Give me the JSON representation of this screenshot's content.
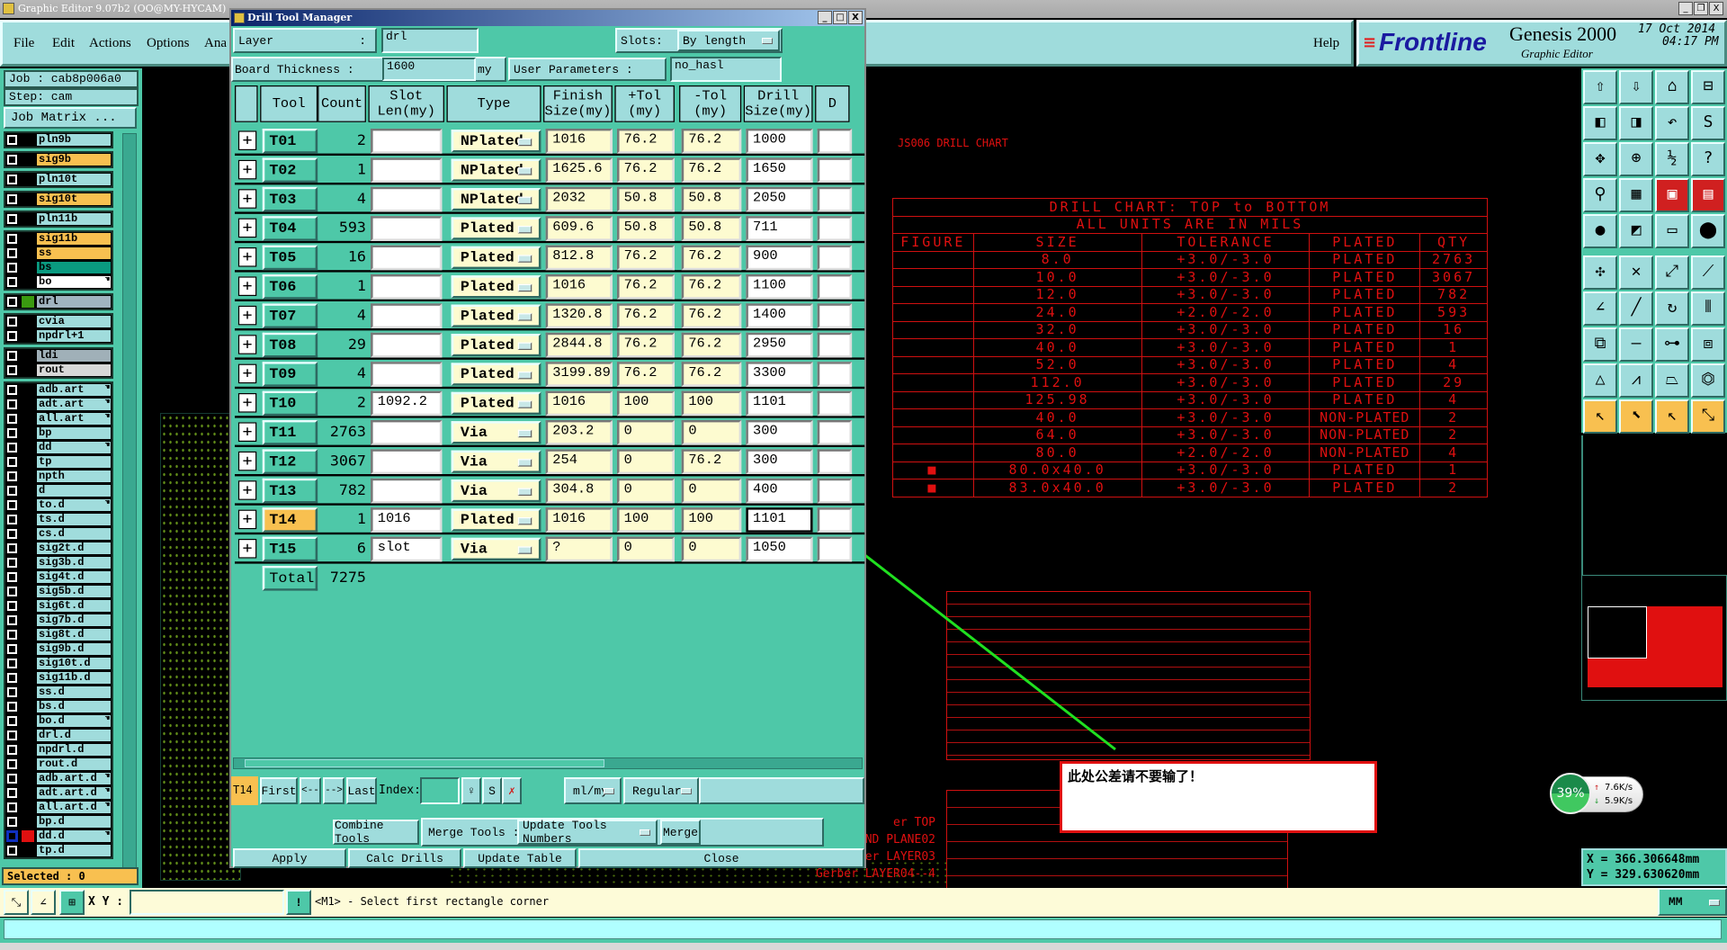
{
  "app": {
    "title": "Graphic Editor 9.07b2 (OO@MY-HYCAM)",
    "menu": [
      "File",
      "Edit",
      "Actions",
      "Options",
      "Ana"
    ],
    "help": "Help",
    "brand": "Frontline",
    "product": "Genesis 2000",
    "subtitle": "Graphic Editor",
    "date": "17 Oct 2014",
    "time": "04:17 PM"
  },
  "left_panel": {
    "job": "Job : cab8p006a0",
    "step": "Step: cam",
    "job_matrix": "Job Matrix ...",
    "layer_groups": [
      [
        {
          "name": "pln9b",
          "color": "#a0dcdc"
        }
      ],
      [
        {
          "name": "sig9b",
          "color": "#f8c050"
        }
      ],
      [
        {
          "name": "pln10t",
          "color": "#a0dcdc"
        }
      ],
      [
        {
          "name": "sig10t",
          "color": "#f8c050"
        }
      ],
      [
        {
          "name": "pln11b",
          "color": "#a0dcdc"
        }
      ],
      [
        {
          "name": "sig11b",
          "color": "#f8c050"
        },
        {
          "name": "ss",
          "color": "#f8c050"
        },
        {
          "name": "bs",
          "color": "#0a9a80"
        },
        {
          "name": "bo",
          "color": "#ffffff",
          "hand": true
        }
      ],
      [
        {
          "name": "drl",
          "color": "#a0b4c0",
          "swatch": "#3a9a10"
        }
      ],
      [
        {
          "name": "cvia",
          "color": "#a0dcdc"
        },
        {
          "name": "npdrl+1",
          "color": "#a0dcdc"
        }
      ],
      [
        {
          "name": "ldi",
          "color": "#a0b0b8"
        },
        {
          "name": "rout",
          "color": "#d8d8d8"
        }
      ],
      [
        {
          "name": "adb.art",
          "color": "#a0dcdc",
          "hand": true
        },
        {
          "name": "adt.art",
          "color": "#a0dcdc",
          "hand": true
        },
        {
          "name": "all.art",
          "color": "#a0dcdc",
          "hand": true
        },
        {
          "name": "bp",
          "color": "#a0dcdc"
        },
        {
          "name": "dd",
          "color": "#a0dcdc",
          "hand": true
        },
        {
          "name": "tp",
          "color": "#a0dcdc"
        },
        {
          "name": "npth",
          "color": "#a0dcdc"
        },
        {
          "name": "d",
          "color": "#a0dcdc"
        },
        {
          "name": "to.d",
          "color": "#a0dcdc",
          "hand": true
        },
        {
          "name": "ts.d",
          "color": "#a0dcdc"
        },
        {
          "name": "cs.d",
          "color": "#a0dcdc"
        },
        {
          "name": "sig2t.d",
          "color": "#a0dcdc"
        },
        {
          "name": "sig3b.d",
          "color": "#a0dcdc"
        },
        {
          "name": "sig4t.d",
          "color": "#a0dcdc"
        },
        {
          "name": "sig5b.d",
          "color": "#a0dcdc"
        },
        {
          "name": "sig6t.d",
          "color": "#a0dcdc"
        },
        {
          "name": "sig7b.d",
          "color": "#a0dcdc"
        },
        {
          "name": "sig8t.d",
          "color": "#a0dcdc"
        },
        {
          "name": "sig9b.d",
          "color": "#a0dcdc"
        },
        {
          "name": "sig10t.d",
          "color": "#a0dcdc"
        },
        {
          "name": "sig11b.d",
          "color": "#a0dcdc"
        },
        {
          "name": "ss.d",
          "color": "#a0dcdc"
        },
        {
          "name": "bs.d",
          "color": "#a0dcdc"
        },
        {
          "name": "bo.d",
          "color": "#a0dcdc",
          "hand": true
        },
        {
          "name": "drl.d",
          "color": "#a0dcdc"
        },
        {
          "name": "npdrl.d",
          "color": "#a0dcdc"
        },
        {
          "name": "rout.d",
          "color": "#a0dcdc"
        },
        {
          "name": "adb.art.d",
          "color": "#a0dcdc",
          "hand": true
        },
        {
          "name": "adt.art.d",
          "color": "#a0dcdc",
          "hand": true
        },
        {
          "name": "all.art.d",
          "color": "#a0dcdc",
          "hand": true
        },
        {
          "name": "bp.d",
          "color": "#a0dcdc"
        },
        {
          "name": "dd.d",
          "color": "#a0dcdc",
          "hand": true,
          "swatch": "#e01010",
          "active": true
        },
        {
          "name": "tp.d",
          "color": "#a0dcdc"
        }
      ]
    ],
    "selected": "Selected : 0"
  },
  "dialog": {
    "title": "Drill Tool Manager",
    "layer_label": "Layer",
    "layer_colon": ":",
    "layer_value": "drl",
    "slots_label": "Slots:",
    "slots_value": "By length",
    "thickness_label": "Board Thickness :",
    "thickness_value": "1600",
    "thickness_unit": "my",
    "user_params_label": "User Parameters :",
    "user_params_value": "no_hasl",
    "columns": [
      "Tool",
      "Count",
      "Slot\nLen(my)",
      "Type",
      "Finish\nSize(my)",
      "+Tol\n(my)",
      "-Tol\n(my)",
      "Drill\nSize(my)",
      "D"
    ],
    "rows": [
      {
        "tool": "T01",
        "count": "2",
        "slot": "",
        "type": "NPlated",
        "finish": "1016",
        "ptol": "76.2",
        "mtol": "76.2",
        "drill": "1000"
      },
      {
        "tool": "T02",
        "count": "1",
        "slot": "",
        "type": "NPlated",
        "finish": "1625.6",
        "ptol": "76.2",
        "mtol": "76.2",
        "drill": "1650"
      },
      {
        "tool": "T03",
        "count": "4",
        "slot": "",
        "type": "NPlated",
        "finish": "2032",
        "ptol": "50.8",
        "mtol": "50.8",
        "drill": "2050"
      },
      {
        "tool": "T04",
        "count": "593",
        "slot": "",
        "type": "Plated",
        "finish": "609.6",
        "ptol": "50.8",
        "mtol": "50.8",
        "drill": "711"
      },
      {
        "tool": "T05",
        "count": "16",
        "slot": "",
        "type": "Plated",
        "finish": "812.8",
        "ptol": "76.2",
        "mtol": "76.2",
        "drill": "900"
      },
      {
        "tool": "T06",
        "count": "1",
        "slot": "",
        "type": "Plated",
        "finish": "1016",
        "ptol": "76.2",
        "mtol": "76.2",
        "drill": "1100"
      },
      {
        "tool": "T07",
        "count": "4",
        "slot": "",
        "type": "Plated",
        "finish": "1320.8",
        "ptol": "76.2",
        "mtol": "76.2",
        "drill": "1400"
      },
      {
        "tool": "T08",
        "count": "29",
        "slot": "",
        "type": "Plated",
        "finish": "2844.8",
        "ptol": "76.2",
        "mtol": "76.2",
        "drill": "2950"
      },
      {
        "tool": "T09",
        "count": "4",
        "slot": "",
        "type": "Plated",
        "finish": "3199.89",
        "ptol": "76.2",
        "mtol": "76.2",
        "drill": "3300"
      },
      {
        "tool": "T10",
        "count": "2",
        "slot": "1092.2",
        "type": "Plated",
        "finish": "1016",
        "ptol": "100",
        "mtol": "100",
        "drill": "1101"
      },
      {
        "tool": "T11",
        "count": "2763",
        "slot": "",
        "type": "Via",
        "finish": "203.2",
        "ptol": "0",
        "mtol": "0",
        "drill": "300"
      },
      {
        "tool": "T12",
        "count": "3067",
        "slot": "",
        "type": "Via",
        "finish": "254",
        "ptol": "0",
        "mtol": "76.2",
        "drill": "300"
      },
      {
        "tool": "T13",
        "count": "782",
        "slot": "",
        "type": "Via",
        "finish": "304.8",
        "ptol": "0",
        "mtol": "0",
        "drill": "400"
      },
      {
        "tool": "T14",
        "count": "1",
        "slot": "1016",
        "type": "Plated",
        "finish": "1016",
        "ptol": "100",
        "mtol": "100",
        "drill": "1101",
        "selected": true
      },
      {
        "tool": "T15",
        "count": "6",
        "slot": "slot",
        "type": "Via",
        "finish": "?",
        "ptol": "0",
        "mtol": "0",
        "drill": "1050"
      }
    ],
    "total_label": "Total",
    "total_count": "7275",
    "current_tool": "T14",
    "nav": {
      "first": "First",
      "prev": "<--",
      "next": "-->",
      "last": "Last",
      "index_label": "Index:",
      "index_value": ""
    },
    "units": "ml/my",
    "mode": "Regular",
    "combine": "Combine Tools",
    "merge_label": "Merge Tools :",
    "merge_option": "Update Tools Numbers",
    "merge": "Merge",
    "apply": "Apply",
    "calc": "Calc Drills",
    "update": "Update Table",
    "close": "Close"
  },
  "drawing": {
    "chart_label": "JS006 DRILL CHART",
    "chart_title": "DRILL CHART: TOP to BOTTOM",
    "chart_units": "ALL UNITS ARE IN MILS",
    "chart_headers": [
      "FIGURE",
      "SIZE",
      "TOLERANCE",
      "PLATED",
      "QTY"
    ],
    "chart_rows": [
      [
        "",
        "8.0",
        "+3.0/-3.0",
        "PLATED",
        "2763"
      ],
      [
        "",
        "10.0",
        "+3.0/-3.0",
        "PLATED",
        "3067"
      ],
      [
        "",
        "12.0",
        "+3.0/-3.0",
        "PLATED",
        "782"
      ],
      [
        "",
        "24.0",
        "+2.0/-2.0",
        "PLATED",
        "593"
      ],
      [
        "",
        "32.0",
        "+3.0/-3.0",
        "PLATED",
        "16"
      ],
      [
        "",
        "40.0",
        "+3.0/-3.0",
        "PLATED",
        "1"
      ],
      [
        "",
        "52.0",
        "+3.0/-3.0",
        "PLATED",
        "4"
      ],
      [
        "",
        "112.0",
        "+3.0/-3.0",
        "PLATED",
        "29"
      ],
      [
        "",
        "125.98",
        "+3.0/-3.0",
        "PLATED",
        "4"
      ],
      [
        "",
        "40.0",
        "+3.0/-3.0",
        "NON-PLATED",
        "2"
      ],
      [
        "",
        "64.0",
        "+3.0/-3.0",
        "NON-PLATED",
        "2"
      ],
      [
        "",
        "80.0",
        "+2.0/-2.0",
        "NON-PLATED",
        "4"
      ],
      [
        "■",
        "80.0x40.0",
        "+3.0/-3.0",
        "PLATED",
        "1"
      ],
      [
        "■",
        "83.0x40.0",
        "+3.0/-3.0",
        "PLATED",
        "2"
      ]
    ],
    "gerber_labels": [
      "er TOP",
      "ND PLANE02",
      "er LAYER03",
      "4--Gerber LAYER04"
    ],
    "annotation": "此处公差请不要输了！"
  },
  "network": {
    "percent": "39%",
    "up": "7.6K/s",
    "down": "5.9K/s"
  },
  "coords": {
    "x": "X = 366.306648mm",
    "y": "Y = 329.630620mm"
  },
  "status": {
    "xy_label": "X Y :",
    "xy_value": "",
    "prompt": "<M1> - Select first rectangle corner",
    "units": "MM"
  },
  "colors": {
    "accent": "#4ec8a8",
    "panel": "#9fdcdc",
    "highlight": "#f8c050",
    "drawing": "#e01010",
    "arrow": "#20e020"
  }
}
